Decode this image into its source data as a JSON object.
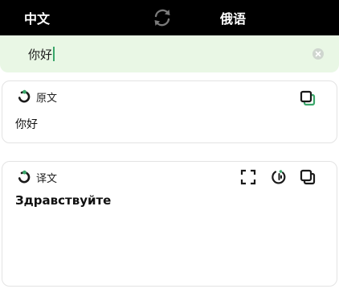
{
  "languages": {
    "source": "中文",
    "target": "俄语"
  },
  "input": {
    "value": "你好"
  },
  "source_card": {
    "title": "原文",
    "text": "你好"
  },
  "result_card": {
    "title": "译文",
    "text": "Здравствуйте"
  },
  "icons": {
    "swap": "refresh-swap-icon",
    "clear": "clear-icon",
    "copy": "copy-icon",
    "fullscreen": "fullscreen-icon",
    "speak": "speak-icon"
  },
  "colors": {
    "accent": "#3aa66a",
    "bar": "#000000",
    "input_bg": "#e9f7e5"
  }
}
